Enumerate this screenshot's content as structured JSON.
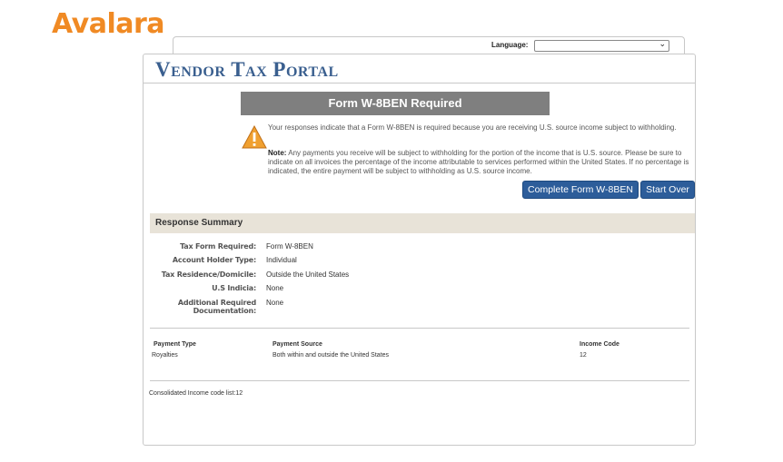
{
  "brand": {
    "logo_text": "Avalara",
    "logo_color": "#f08a24"
  },
  "header": {
    "language_label": "Language:",
    "language_value": ""
  },
  "portal": {
    "title": "Vendor Tax Portal",
    "title_color": "#3a5f8f"
  },
  "banner": {
    "text": "Form W-8BEN Required"
  },
  "message": {
    "line1": "Your responses indicate that a Form W-8BEN is required because you are receiving U.S. source income subject to withholding.",
    "note_label": "Note:",
    "note_text": " Any payments you receive will be subject to withholding for the portion of the income that is U.S. source. Please be sure to indicate on all invoices the percentage of the income attributable to services performed within the United States. If no percentage is indicated, the entire payment will be subject to withholding as U.S. source income."
  },
  "buttons": {
    "complete": "Complete Form W-8BEN",
    "start_over": "Start Over",
    "color": "#2d5d9a"
  },
  "summary": {
    "title": "Response Summary",
    "rows": [
      {
        "label": "Tax Form Required:",
        "value": "Form W-8BEN"
      },
      {
        "label": "Account Holder Type:",
        "value": "Individual"
      },
      {
        "label": "Tax Residence/Domicile:",
        "value": "Outside the United States"
      },
      {
        "label": "U.S Indicia:",
        "value": "None"
      },
      {
        "label": "Additional Required Documentation:",
        "value": "None"
      }
    ]
  },
  "payments": {
    "headers": [
      "Payment Type",
      "Payment Source",
      "Income Code"
    ],
    "rows": [
      [
        "Royalties",
        "Both within and outside the United States",
        "12"
      ]
    ],
    "consolidated": "Consolidated Income code list:12"
  }
}
